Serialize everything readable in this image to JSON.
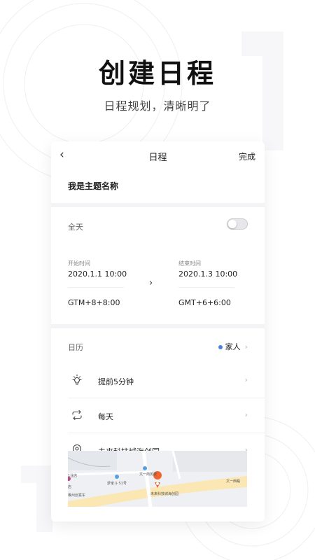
{
  "hero": {
    "title": "创建日程",
    "subtitle": "日程规划，清晰明了"
  },
  "nav": {
    "back_icon": "chevron-left-icon",
    "title": "日程",
    "done_label": "完成"
  },
  "subject": {
    "value": "我是主题名称"
  },
  "time": {
    "all_day_label": "全天",
    "all_day_on": false,
    "start": {
      "label": "开始时间",
      "value": "2020.1.1 10:00",
      "timezone": "GTM+8+8:00"
    },
    "end": {
      "label": "结束时间",
      "value": "2020.1.3 10:00",
      "timezone": "GMT+6+6:00"
    }
  },
  "calendar": {
    "label": "日历",
    "value": "家人",
    "dot_color": "#4a7fe8"
  },
  "items": [
    {
      "icon": "lightbulb-icon",
      "label": "提前5分钟"
    },
    {
      "icon": "repeat-icon",
      "label": "每天"
    },
    {
      "icon": "location-pin-icon",
      "label": "未来科技城海创园"
    }
  ],
  "map": {
    "labels": {
      "road": "文一西路",
      "poi": "未来科技城海创园",
      "poi2": "文一商务楼",
      "a": "梦家斗·51号",
      "b": "1业店",
      "c": "店",
      "d": "琳州创意车"
    },
    "pin_color": "#f0632e"
  }
}
